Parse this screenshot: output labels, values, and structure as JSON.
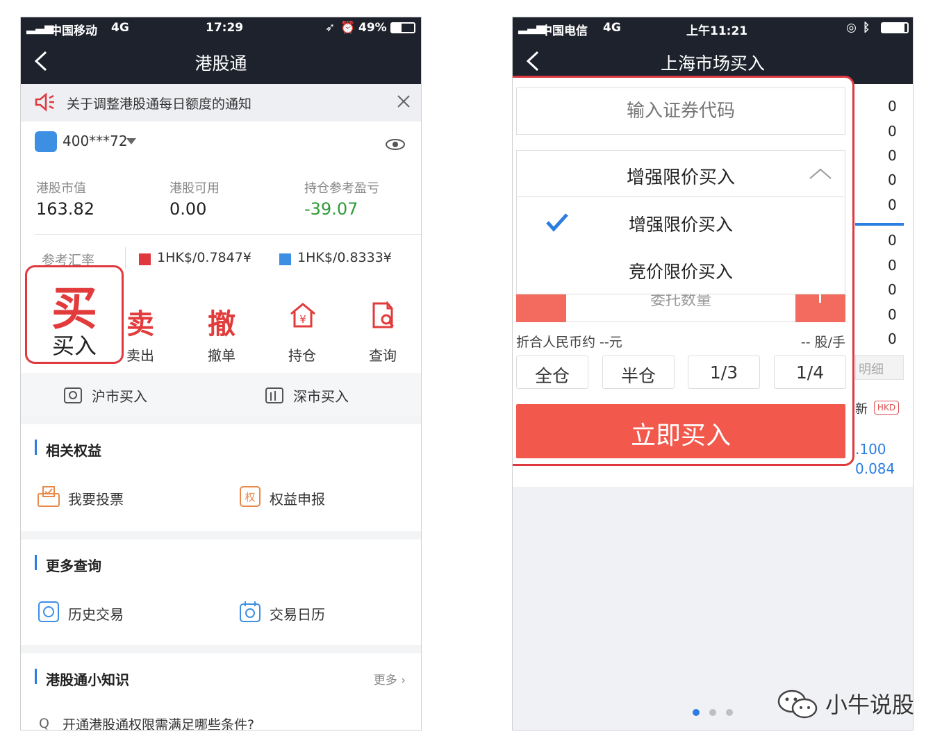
{
  "left": {
    "status": {
      "carrier": "中国移动",
      "network": "4G",
      "time": "17:29",
      "battery": "49%"
    },
    "title": "港股通",
    "notice": "关于调整港股通每日额度的通知",
    "account_id": "400***72",
    "stats": [
      {
        "label": "港股市值",
        "value": "163.82"
      },
      {
        "label": "港股可用",
        "value": "0.00"
      },
      {
        "label": "持仓参考盈亏",
        "value": "-39.07",
        "color": "#2f9a36"
      }
    ],
    "rate_label": "参考汇率",
    "rates": [
      "1HK$/0.7847¥",
      "1HK$/0.8333¥"
    ],
    "buy_glyph": "买",
    "buy_label": "买入",
    "actions": [
      {
        "glyph": "卖",
        "label": "卖出"
      },
      {
        "glyph": "撤",
        "label": "撤单"
      },
      {
        "glyph": "",
        "label": "持仓",
        "icon": "house-yen-icon"
      },
      {
        "glyph": "",
        "label": "查询",
        "icon": "document-search-icon"
      }
    ],
    "markets": [
      "沪市买入",
      "深市买入"
    ],
    "section1": {
      "title": "相关权益",
      "items": [
        "我要投票",
        "权益申报"
      ]
    },
    "section2": {
      "title": "更多查询",
      "items": [
        "历史交易",
        "交易日历"
      ]
    },
    "section3": {
      "title": "港股通小知识",
      "more": "更多",
      "question": "开通港股通权限需满足哪些条件?"
    }
  },
  "right": {
    "status": {
      "carrier": "中国电信",
      "network": "4G",
      "time": "上午11:21"
    },
    "title": "上海市场买入",
    "code_placeholder": "输入证券代码",
    "order_type": "增强限价买入",
    "options": [
      "增强限价买入",
      "竞价限价买入"
    ],
    "qty_placeholder": "委托数量",
    "convert_left": "折合人民币约 --元",
    "convert_right": "-- 股/手",
    "fractions": [
      "全仓",
      "半仓",
      "1/3",
      "1/4"
    ],
    "buy_now": "立即买入",
    "zeros": [
      "0",
      "0",
      "0",
      "0",
      "0",
      "0",
      "0",
      "0",
      "0",
      "0"
    ],
    "detail": "明细",
    "new_label": "新",
    "hkd": "HKD",
    "price_a": ".100",
    "price_b": "0.084"
  },
  "watermark": "小牛说股",
  "colors": {
    "accent_red": "#e23b3b",
    "nav_dark": "#1d222d",
    "link_blue": "#2a7de1",
    "loss_green": "#2f9a36"
  }
}
